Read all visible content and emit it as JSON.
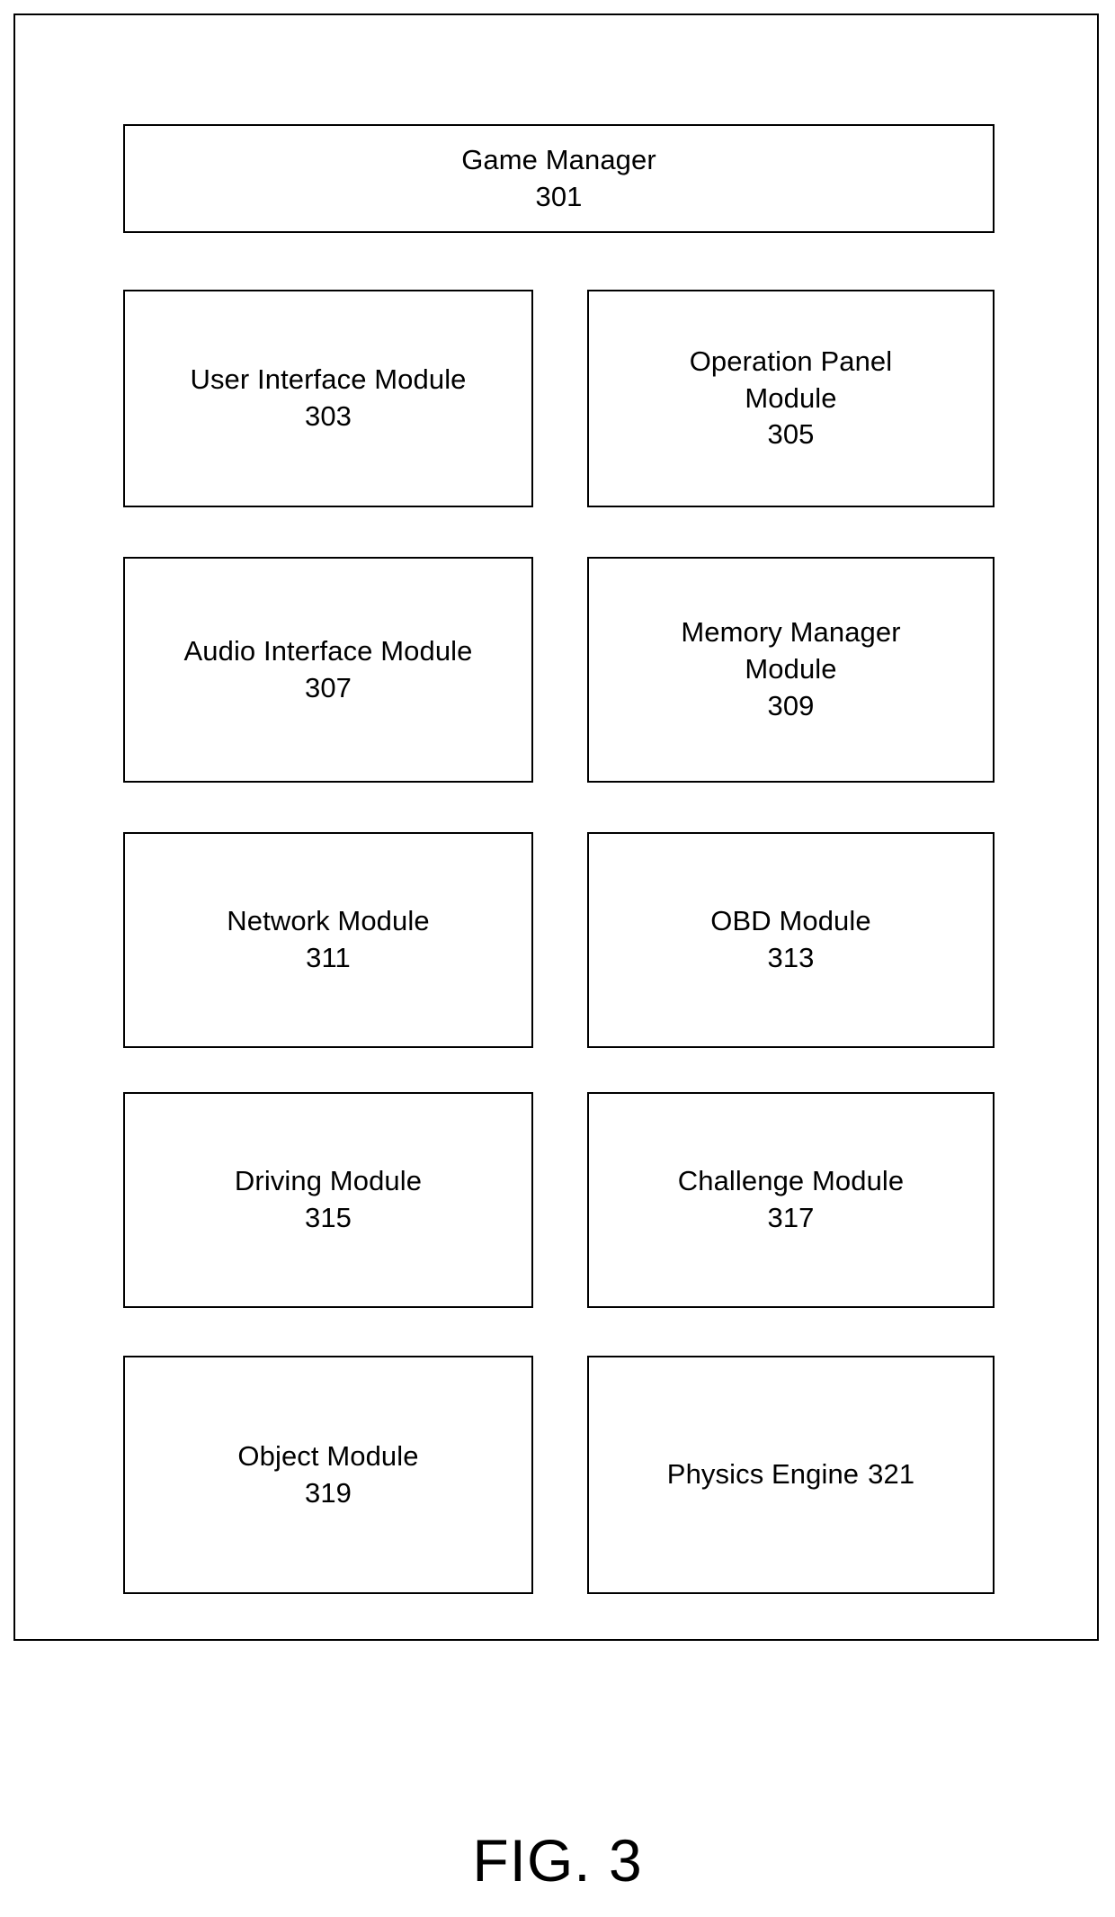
{
  "figure": {
    "caption": "FIG. 3",
    "frame_color": "#000000",
    "background_color": "#ffffff",
    "text_color": "#000000"
  },
  "diagram": {
    "header": {
      "label": "Game Manager",
      "ref": "301"
    },
    "modules": [
      {
        "label": "User Interface Module",
        "ref": "303",
        "column": "left",
        "row": 2,
        "inline_ref": false
      },
      {
        "label": "Operation Panel\nModule",
        "ref": "305",
        "column": "right",
        "row": 2,
        "inline_ref": false
      },
      {
        "label": "Audio Interface Module",
        "ref": "307",
        "column": "left",
        "row": 3,
        "inline_ref": false
      },
      {
        "label": "Memory Manager\nModule",
        "ref": "309",
        "column": "right",
        "row": 3,
        "inline_ref": false
      },
      {
        "label": "Network Module",
        "ref": "311",
        "column": "left",
        "row": 4,
        "inline_ref": false
      },
      {
        "label": "OBD Module",
        "ref": "313",
        "column": "right",
        "row": 4,
        "inline_ref": false
      },
      {
        "label": "Driving Module",
        "ref": "315",
        "column": "left",
        "row": 5,
        "inline_ref": false
      },
      {
        "label": "Challenge Module",
        "ref": "317",
        "column": "right",
        "row": 5,
        "inline_ref": false
      },
      {
        "label": "Object Module",
        "ref": "319",
        "column": "left",
        "row": 6,
        "inline_ref": false
      },
      {
        "label": "Physics Engine",
        "ref": "321",
        "column": "right",
        "row": 6,
        "inline_ref": true
      }
    ]
  }
}
